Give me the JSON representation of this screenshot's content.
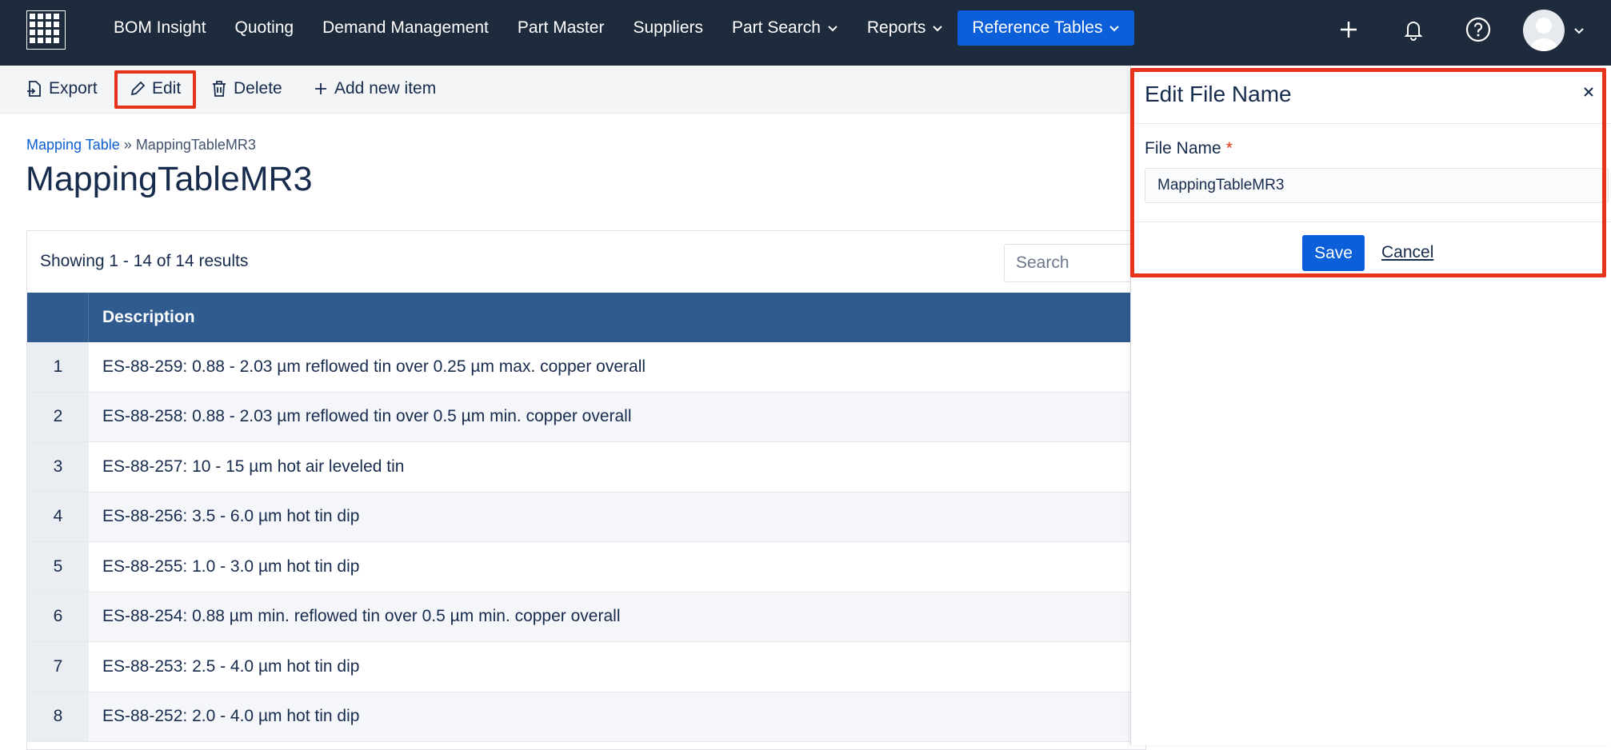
{
  "nav": {
    "items": [
      {
        "label": "BOM Insight"
      },
      {
        "label": "Quoting"
      },
      {
        "label": "Demand Management"
      },
      {
        "label": "Part Master"
      },
      {
        "label": "Suppliers"
      },
      {
        "label": "Part Search"
      },
      {
        "label": "Reports"
      },
      {
        "label": "Reference Tables"
      }
    ],
    "active_item": "Reference Tables",
    "icons": [
      "grid-logo-icon",
      "plus-icon",
      "bell-icon",
      "help-icon",
      "avatar"
    ]
  },
  "toolbar": {
    "export_label": "Export",
    "edit_label": "Edit",
    "delete_label": "Delete",
    "add_label": "Add new item"
  },
  "breadcrumb": {
    "parent": "Mapping Table",
    "separator": "»",
    "current": "MappingTableMR3"
  },
  "page_title": "MappingTableMR3",
  "table": {
    "results_text": "Showing 1 - 14 of 14 results",
    "search_placeholder": "Search",
    "column_header": "Description",
    "rows": [
      {
        "index": "1",
        "description": "ES-88-259: 0.88 - 2.03 µm reflowed tin over 0.25 µm max. copper overall"
      },
      {
        "index": "2",
        "description": "ES-88-258: 0.88 - 2.03 µm reflowed tin over 0.5 µm min. copper overall"
      },
      {
        "index": "3",
        "description": "ES-88-257: 10 - 15 µm hot air leveled tin"
      },
      {
        "index": "4",
        "description": "ES-88-256: 3.5 - 6.0 µm hot tin dip"
      },
      {
        "index": "5",
        "description": "ES-88-255: 1.0 - 3.0 µm hot tin dip"
      },
      {
        "index": "6",
        "description": "ES-88-254: 0.88 µm min. reflowed tin over 0.5 µm min. copper overall"
      },
      {
        "index": "7",
        "description": "ES-88-253: 2.5 - 4.0 µm hot tin dip"
      },
      {
        "index": "8",
        "description": "ES-88-252: 2.0 - 4.0 µm hot tin dip"
      }
    ]
  },
  "panel": {
    "title": "Edit File Name",
    "field_label": "File Name",
    "required_mark": "*",
    "field_value": "MappingTableMR3",
    "save_label": "Save",
    "cancel_label": "Cancel"
  },
  "colors": {
    "nav_bg": "#1e2b3d",
    "accent": "#0b5fd8",
    "table_header": "#2f5b8e",
    "highlight": "#e8331c"
  }
}
